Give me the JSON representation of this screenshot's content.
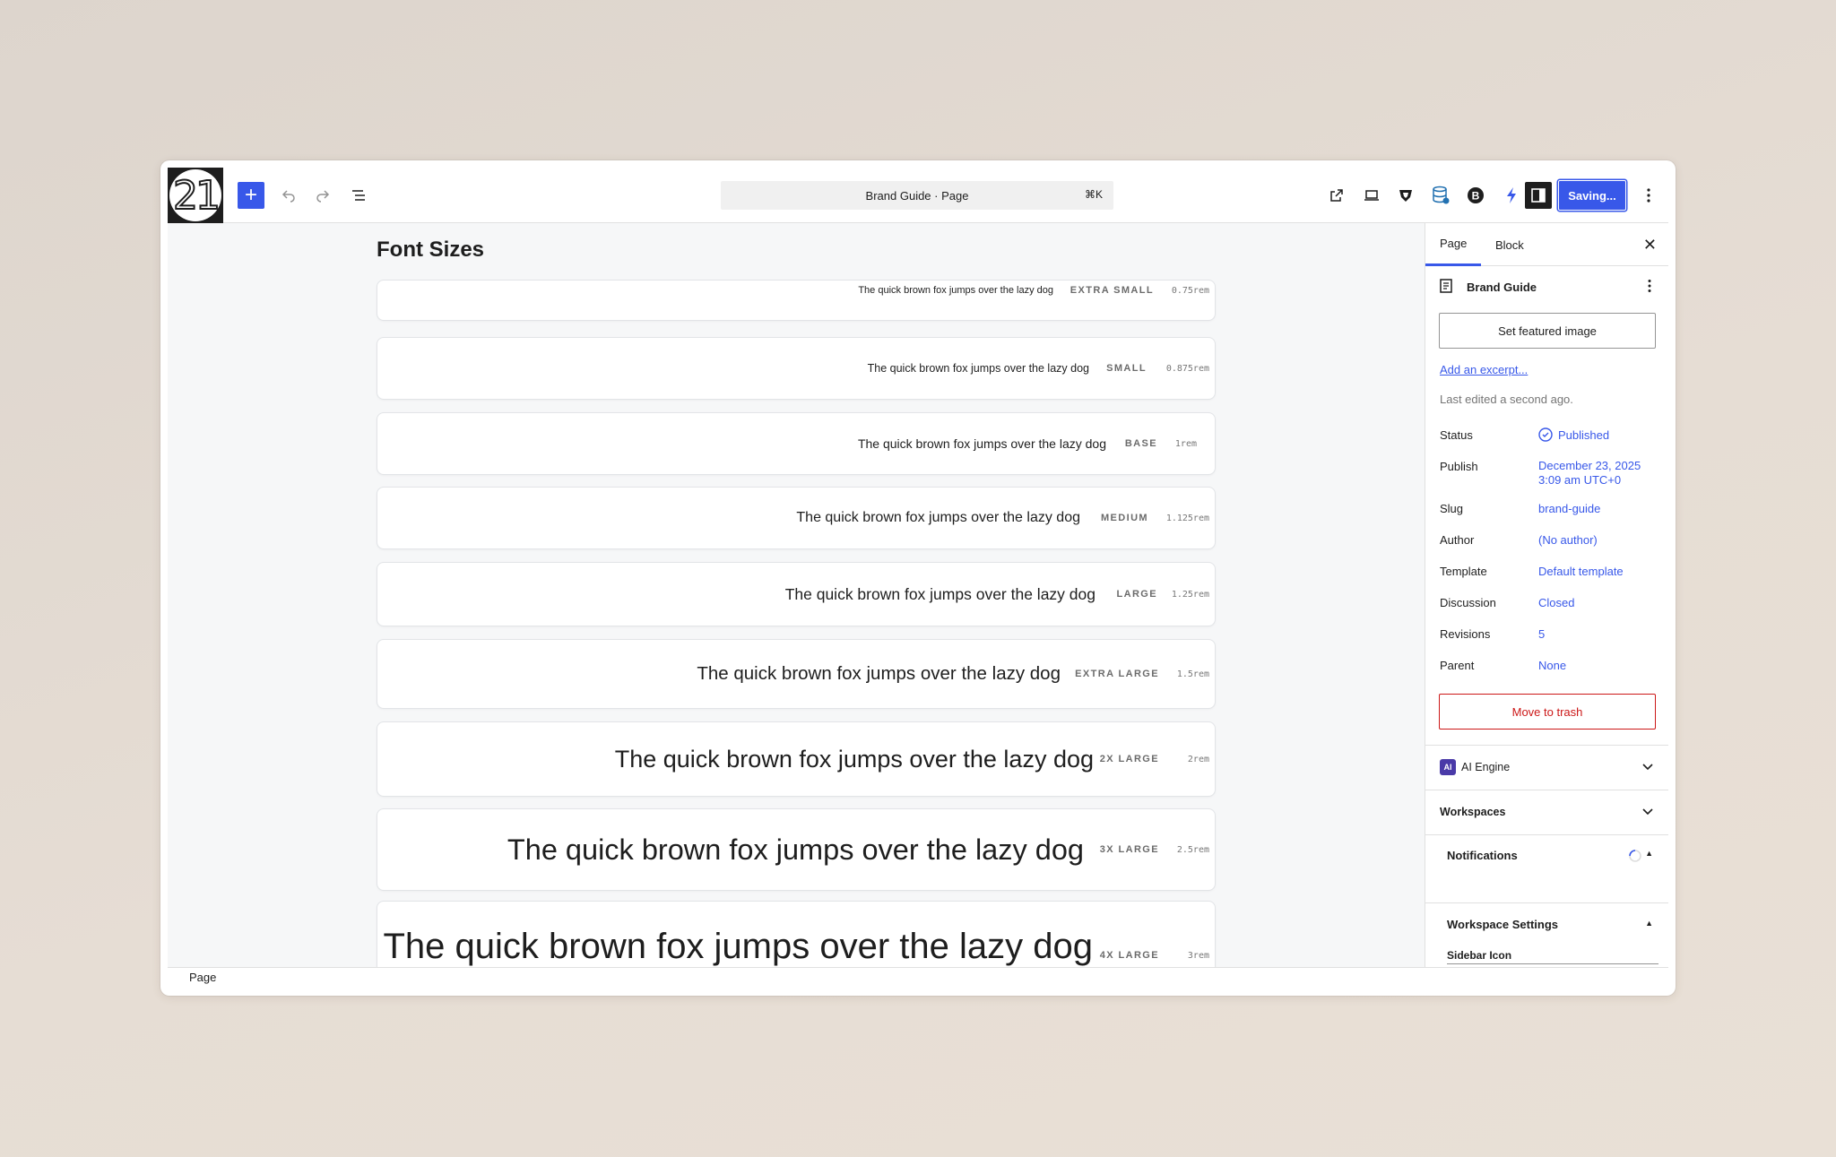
{
  "app": {
    "logo_text": "21",
    "command_bar": {
      "title": "Brand Guide · Page",
      "shortcut": "⌘K"
    },
    "save_label": "Saving...",
    "footer_breadcrumb": "Page"
  },
  "canvas": {
    "heading": "Font Sizes",
    "font_sizes": [
      {
        "sample": "The quick brown fox jumps over the lazy dog",
        "name": "EXTRA SMALL",
        "value": "0.75rem"
      },
      {
        "sample": "The quick brown fox jumps over the lazy dog",
        "name": "SMALL",
        "value": "0.875rem"
      },
      {
        "sample": "The quick brown fox jumps over the lazy dog",
        "name": "BASE",
        "value": "1rem"
      },
      {
        "sample": "The quick brown fox jumps over the lazy dog",
        "name": "MEDIUM",
        "value": "1.125rem"
      },
      {
        "sample": "The quick brown fox jumps over the lazy dog",
        "name": "LARGE",
        "value": "1.25rem"
      },
      {
        "sample": "The quick brown fox jumps over the lazy dog",
        "name": "EXTRA LARGE",
        "value": "1.5rem"
      },
      {
        "sample": "The quick brown fox jumps over the lazy dog",
        "name": "2X LARGE",
        "value": "2rem"
      },
      {
        "sample": "The quick brown fox jumps over the lazy dog",
        "name": "3X LARGE",
        "value": "2.5rem"
      },
      {
        "sample": "The quick brown fox jumps over the lazy dog",
        "name": "4X LARGE",
        "value": "3rem"
      }
    ]
  },
  "sidebar": {
    "tabs": [
      "Page",
      "Block"
    ],
    "doc_title": "Brand Guide",
    "featured_image_label": "Set featured image",
    "excerpt_link": "Add an excerpt...",
    "last_edited": "Last edited a second ago.",
    "rows": {
      "status": {
        "label": "Status",
        "value": "Published"
      },
      "publish": {
        "label": "Publish",
        "value_line1": "December 23, 2025",
        "value_line2": "3:09 am UTC+0"
      },
      "slug": {
        "label": "Slug",
        "value": "brand-guide"
      },
      "author": {
        "label": "Author",
        "value": "(No author)"
      },
      "template": {
        "label": "Template",
        "value": "Default template"
      },
      "discussion": {
        "label": "Discussion",
        "value": "Closed"
      },
      "revisions": {
        "label": "Revisions",
        "value": "5"
      },
      "parent": {
        "label": "Parent",
        "value": "None"
      }
    },
    "trash_label": "Move to trash",
    "panels": {
      "ai_engine": "AI Engine",
      "ai_badge": "AI",
      "workspaces": "Workspaces",
      "notifications": "Notifications",
      "workspace_settings": "Workspace Settings",
      "sidebar_icon": "Sidebar Icon"
    }
  }
}
